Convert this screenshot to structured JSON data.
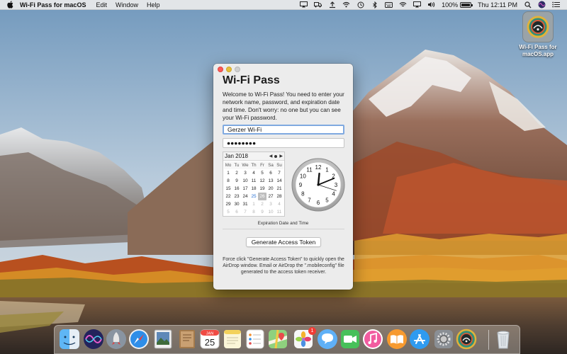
{
  "menubar": {
    "app_name": "Wi-Fi Pass for macOS",
    "menus": [
      "Edit",
      "Window",
      "Help"
    ],
    "battery_percent": "100%",
    "clock": "Thu 12:11 PM"
  },
  "desktop_icon": {
    "label": "Wi-Fi Pass for macOS.app"
  },
  "window": {
    "title": "Wi-Fi Pass",
    "description": "Welcome to Wi-Fi Pass! You need to enter your network name, password, and expiration date and time. Don't worry: no one but you can see your Wi-Fi password.",
    "network_name": "Gerzer Wi-Fi",
    "password_mask": "●●●●●●●●",
    "calendar": {
      "month": "Jan 2018",
      "weekdays": [
        "Mo",
        "Tu",
        "We",
        "Th",
        "Fr",
        "Sa",
        "Su"
      ],
      "days": [
        {
          "d": "1",
          "s": ""
        },
        {
          "d": "2",
          "s": ""
        },
        {
          "d": "3",
          "s": ""
        },
        {
          "d": "4",
          "s": ""
        },
        {
          "d": "5",
          "s": ""
        },
        {
          "d": "6",
          "s": ""
        },
        {
          "d": "7",
          "s": ""
        },
        {
          "d": "8",
          "s": ""
        },
        {
          "d": "9",
          "s": ""
        },
        {
          "d": "10",
          "s": ""
        },
        {
          "d": "11",
          "s": ""
        },
        {
          "d": "12",
          "s": ""
        },
        {
          "d": "13",
          "s": ""
        },
        {
          "d": "14",
          "s": ""
        },
        {
          "d": "15",
          "s": ""
        },
        {
          "d": "16",
          "s": ""
        },
        {
          "d": "17",
          "s": ""
        },
        {
          "d": "18",
          "s": ""
        },
        {
          "d": "19",
          "s": ""
        },
        {
          "d": "20",
          "s": ""
        },
        {
          "d": "21",
          "s": ""
        },
        {
          "d": "22",
          "s": ""
        },
        {
          "d": "23",
          "s": ""
        },
        {
          "d": "24",
          "s": ""
        },
        {
          "d": "25",
          "s": "today"
        },
        {
          "d": "26",
          "s": "sel"
        },
        {
          "d": "27",
          "s": ""
        },
        {
          "d": "28",
          "s": ""
        },
        {
          "d": "29",
          "s": ""
        },
        {
          "d": "30",
          "s": ""
        },
        {
          "d": "31",
          "s": ""
        },
        {
          "d": "1",
          "s": "muted"
        },
        {
          "d": "2",
          "s": "muted"
        },
        {
          "d": "3",
          "s": "muted"
        },
        {
          "d": "4",
          "s": "muted"
        },
        {
          "d": "5",
          "s": "muted"
        },
        {
          "d": "6",
          "s": "muted"
        },
        {
          "d": "7",
          "s": "muted"
        },
        {
          "d": "8",
          "s": "muted"
        },
        {
          "d": "9",
          "s": "muted"
        },
        {
          "d": "10",
          "s": "muted"
        },
        {
          "d": "11",
          "s": "muted"
        }
      ]
    },
    "clock": {
      "numbers": [
        "12",
        "1",
        "2",
        "3",
        "4",
        "5",
        "6",
        "7",
        "8",
        "9",
        "10",
        "11"
      ],
      "hour": 12,
      "minute": 11,
      "second": 18
    },
    "datetime_label": "Expiration Date and Time",
    "generate_button": "Generate Access Token",
    "hint": "Force click \"Generate Access Token\" to quickly open the AirDrop window. Email or AirDrop the \".mobileconfig\" file generated to the access token receiver."
  },
  "dock": {
    "items": [
      {
        "name": "finder",
        "color": "#4aa6f0"
      },
      {
        "name": "siri",
        "color": "#2b2b6e"
      },
      {
        "name": "launchpad",
        "color": "#6f7b88"
      },
      {
        "name": "safari",
        "color": "#2f8ee8"
      },
      {
        "name": "preview",
        "color": "#5e88b8"
      },
      {
        "name": "notefile",
        "color": "#a47a4b"
      },
      {
        "name": "calendar",
        "color": "#ffffff"
      },
      {
        "name": "notes",
        "color": "#f6e27a"
      },
      {
        "name": "reminders",
        "color": "#f7f7f7"
      },
      {
        "name": "maps",
        "color": "#7fc46f"
      },
      {
        "name": "photos",
        "color": "#f4f4f4"
      },
      {
        "name": "messages",
        "color": "#5fb0f7"
      },
      {
        "name": "facetime",
        "color": "#47c05a"
      },
      {
        "name": "music",
        "color": "#f25ca0"
      },
      {
        "name": "books",
        "color": "#f79a2f"
      },
      {
        "name": "app-store",
        "color": "#2f9bf0"
      },
      {
        "name": "system-preferences",
        "color": "#8a8f95"
      },
      {
        "name": "wifi-pass",
        "color": "#7f8a8f"
      },
      {
        "name": "trash",
        "color": "#d8dde2"
      }
    ],
    "calendar_day": "25",
    "calendar_month": "JAN",
    "photos_badge": "1"
  }
}
